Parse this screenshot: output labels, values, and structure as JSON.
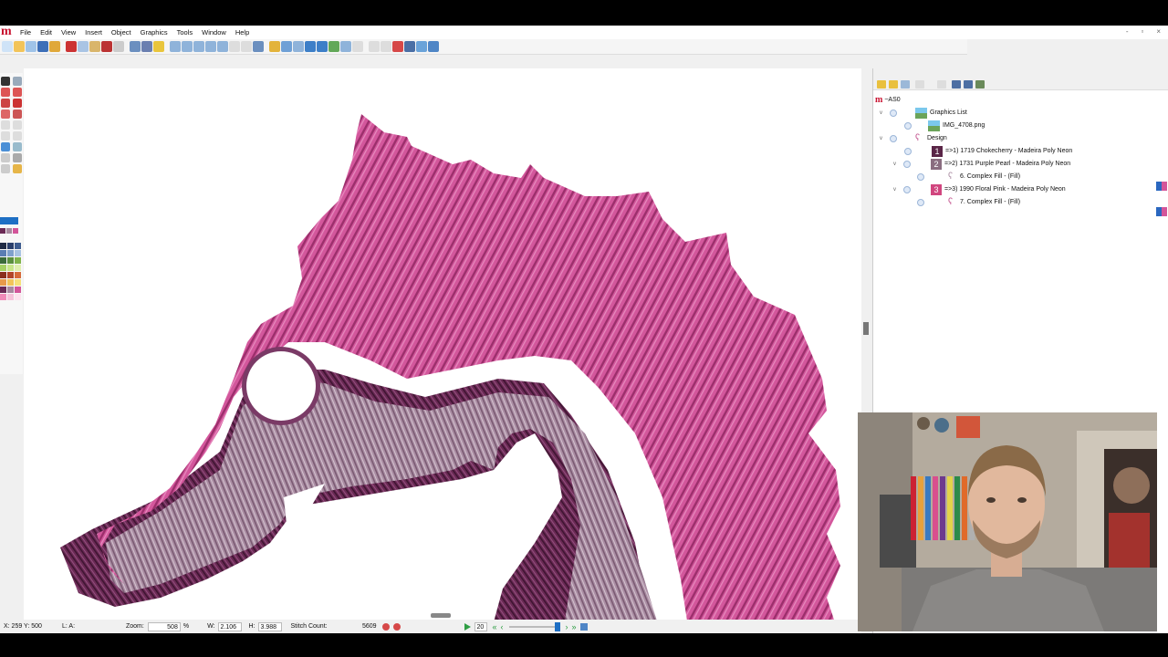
{
  "app": {
    "logo": "m",
    "menu": [
      "File",
      "Edit",
      "View",
      "Insert",
      "Object",
      "Graphics",
      "Tools",
      "Window",
      "Help"
    ],
    "window_controls": [
      "-",
      "▫",
      "×",
      "-",
      "▫",
      "×"
    ]
  },
  "panel": {
    "root_label": "~AS0",
    "tree": [
      {
        "label": "Graphics List",
        "kind": "graphics-list"
      },
      {
        "label": "IMG_4708.png",
        "kind": "image"
      },
      {
        "label": "Design",
        "kind": "design"
      },
      {
        "label": "=>1) 1719 Chokecherry - Madeira Poly Neon",
        "num": "1",
        "color": "#5a2547"
      },
      {
        "label": "=>2) 1731 Purple Pearl - Madeira Poly Neon",
        "num": "2",
        "color": "#8a6d80"
      },
      {
        "label": "6. Complex Fill - (Fill)",
        "kind": "object"
      },
      {
        "label": "=>3) 1990 Floral Pink - Madeira Poly Neon",
        "num": "3",
        "color": "#d1467f"
      },
      {
        "label": "7. Complex Fill - (Fill)",
        "kind": "object"
      }
    ]
  },
  "status": {
    "coords": "X: 259  Y: 500",
    "layer": "L: A:",
    "zoom_label": "Zoom:",
    "zoom_value": "508",
    "zoom_unit": "%",
    "w_label": "W:",
    "w_value": "2.106",
    "h_label": "H:",
    "h_value": "3.988",
    "stitch_label": "Stitch Count:",
    "stitch_value": "5609",
    "speed_value": "20"
  },
  "colors": {
    "pink": "#d3559a",
    "purple_pearl": "#a8899f",
    "chokecherry": "#6b2a55",
    "accent_blue": "#1e6fc4"
  }
}
